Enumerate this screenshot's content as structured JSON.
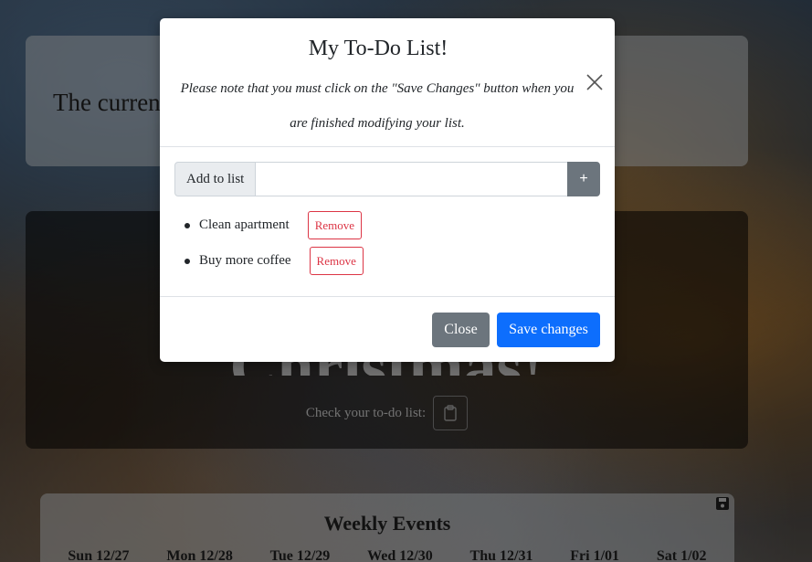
{
  "background": {
    "intro_text": "The curren                                                  ds), with a",
    "check_label": "Check your to-do list:",
    "countdown_text": "Christmas!",
    "weekly_title": "Weekly Events",
    "days": [
      "Sun 12/27",
      "Mon 12/28",
      "Tue 12/29",
      "Wed 12/30",
      "Thu 12/31",
      "Fri 1/01",
      "Sat 1/02"
    ]
  },
  "modal": {
    "title": "My To-Do List!",
    "note": "Please note that you must click on the \"Save Changes\" button when you are finished modifying your list.",
    "add_label": "Add to list",
    "add_input_value": "",
    "add_button": "+",
    "items": [
      {
        "text": "Clean apartment",
        "remove_label": "Remove"
      },
      {
        "text": "Buy more coffee",
        "remove_label": "Remove"
      }
    ],
    "close_label": "Close",
    "save_label": "Save changes"
  },
  "colors": {
    "primary": "#0d6efd",
    "secondary": "#6c757d",
    "danger": "#dc3545"
  }
}
